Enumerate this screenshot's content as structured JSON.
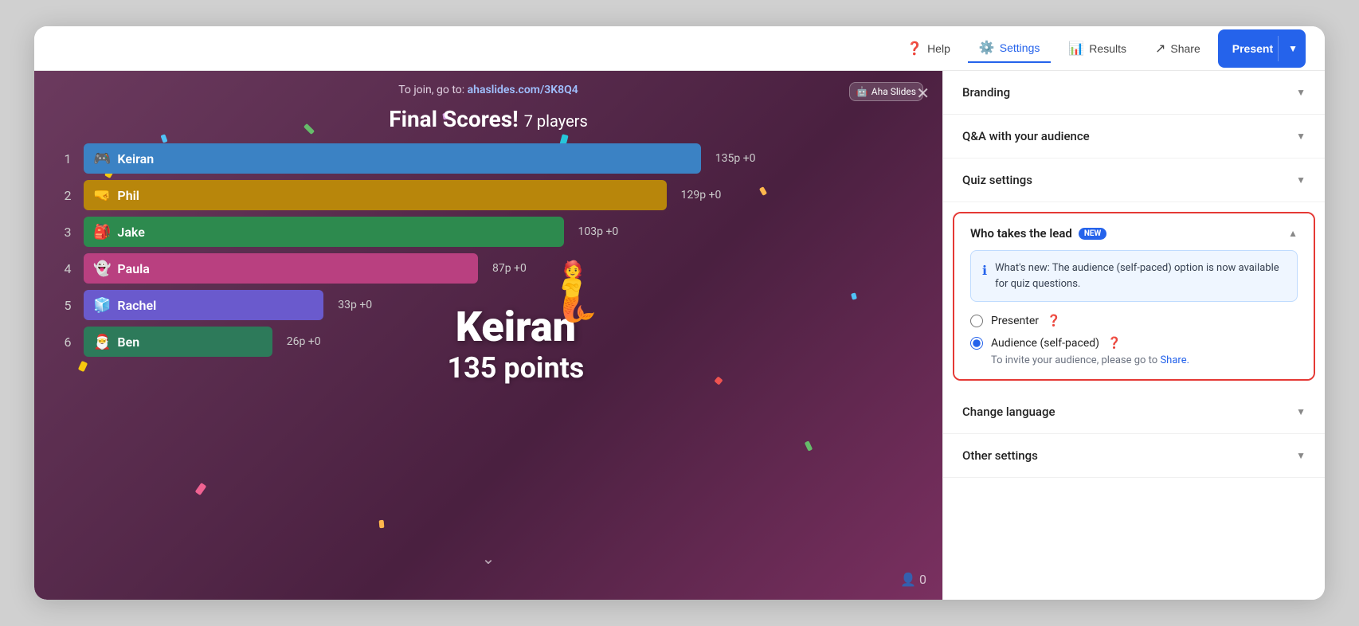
{
  "topbar": {
    "help_label": "Help",
    "settings_label": "Settings",
    "results_label": "Results",
    "share_label": "Share",
    "present_label": "Present"
  },
  "preview": {
    "join_prefix": "To join, go to:",
    "join_url": "ahaslides.com/3K8Q4",
    "aha_badge": "Aha Slides",
    "title": "Final Scores!",
    "players_count": "7 players",
    "overlay_name": "Keiran",
    "overlay_points": "135 points",
    "scores": [
      {
        "rank": "1",
        "name": "Keiran",
        "emoji": "🎮",
        "points": "135p",
        "delta": "+0",
        "color": "#3b82c4",
        "width": "72%"
      },
      {
        "rank": "2",
        "name": "Phil",
        "emoji": "🤜",
        "points": "129p",
        "delta": "+0",
        "color": "#b8860b",
        "width": "68%"
      },
      {
        "rank": "3",
        "name": "Jake",
        "emoji": "🎒",
        "points": "103p",
        "delta": "+0",
        "color": "#2d8a4e",
        "width": "56%"
      },
      {
        "rank": "4",
        "name": "Paula",
        "emoji": "👻",
        "points": "87p",
        "delta": "+0",
        "color": "#b94080",
        "width": "46%"
      },
      {
        "rank": "5",
        "name": "Rachel",
        "emoji": "🧊",
        "points": "33p",
        "delta": "+0",
        "color": "#6a5acd",
        "width": "28%"
      },
      {
        "rank": "6",
        "name": "Ben",
        "emoji": "🎅",
        "points": "26p",
        "delta": "+0",
        "color": "#2d7a5a",
        "width": "22%"
      }
    ],
    "user_count": "0"
  },
  "settings": {
    "branding_label": "Branding",
    "qa_label": "Q&A with your audience",
    "quiz_label": "Quiz settings",
    "lead_label": "Who takes the lead",
    "new_badge": "NEW",
    "lead_info": "What's new: The audience (self-paced) option is now available for quiz questions.",
    "presenter_label": "Presenter",
    "audience_label": "Audience (self-paced)",
    "invite_text": "To invite your audience, please go to",
    "share_link": "Share.",
    "change_language_label": "Change language",
    "other_settings_label": "Other settings"
  }
}
